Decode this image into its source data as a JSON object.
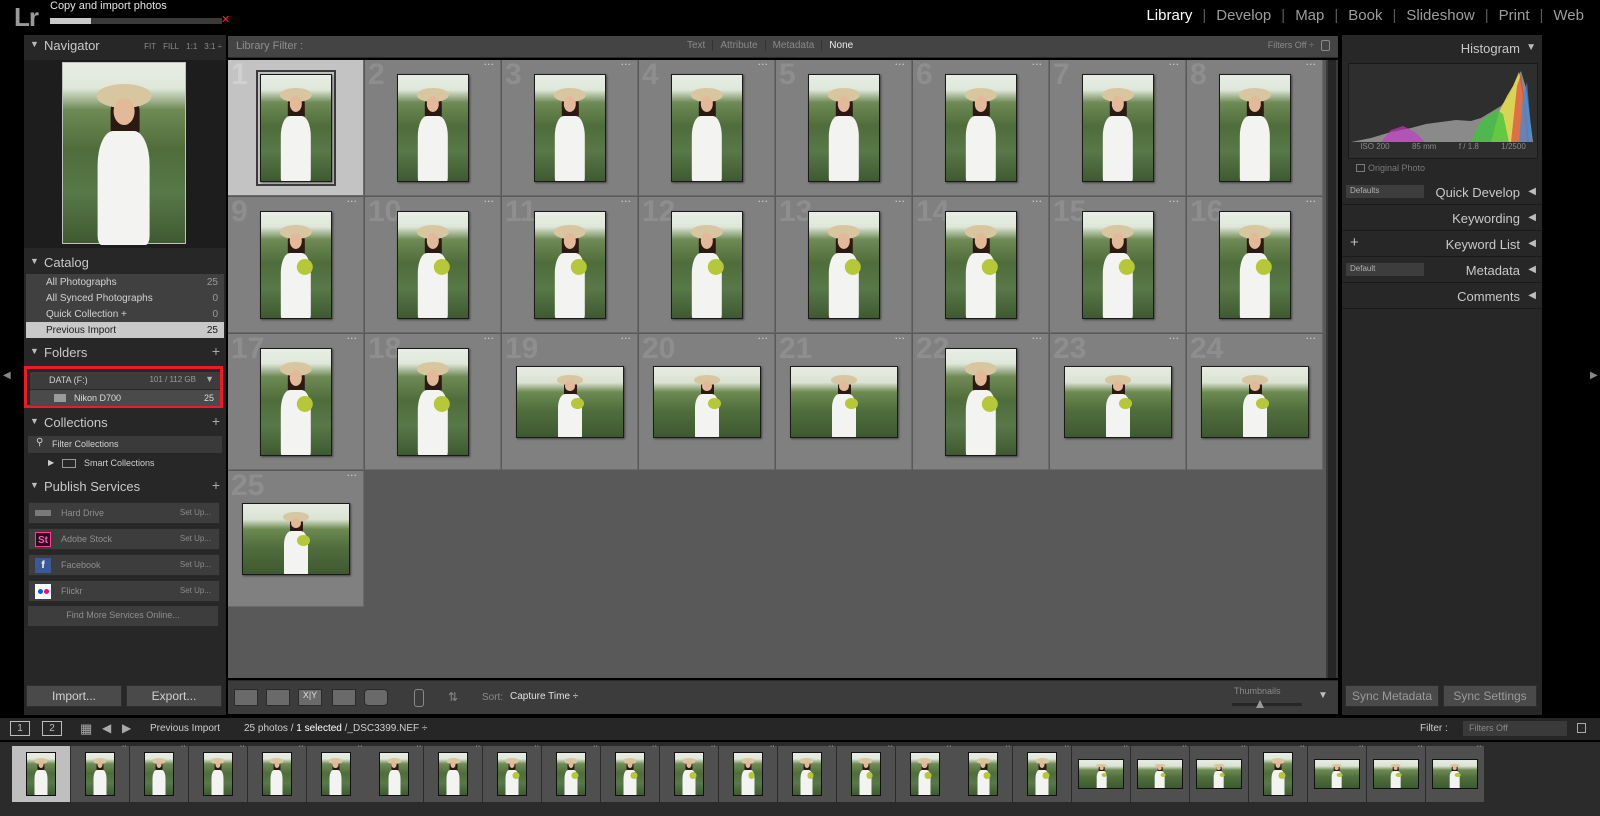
{
  "app": {
    "logo": "Lr"
  },
  "import_status": {
    "label": "Copy and import photos",
    "progress": 0.24
  },
  "modules": [
    "Library",
    "Develop",
    "Map",
    "Book",
    "Slideshow",
    "Print",
    "Web"
  ],
  "active_module": "Library",
  "navigator": {
    "title": "Navigator",
    "options": [
      "FIT",
      "FILL",
      "1:1",
      "3:1 ÷"
    ]
  },
  "catalog": {
    "title": "Catalog",
    "items": [
      {
        "label": "All Photographs",
        "count": "25"
      },
      {
        "label": "All Synced Photographs",
        "count": "0"
      },
      {
        "label": "Quick Collection +",
        "count": "0"
      },
      {
        "label": "Previous Import",
        "count": "25"
      }
    ]
  },
  "folders": {
    "title": "Folders",
    "volume": "DATA (F:)",
    "volume_size": "101 / 112 GB",
    "folder": "Nikon D700",
    "folder_count": "25"
  },
  "collections": {
    "title": "Collections",
    "filter": "Filter Collections",
    "smart": "Smart Collections"
  },
  "publish": {
    "title": "Publish Services",
    "services": [
      {
        "label": "Hard Drive",
        "setup": "Set Up...",
        "icon": "hard-drive-icon"
      },
      {
        "label": "Adobe Stock",
        "setup": "Set Up...",
        "icon": "adobe-stock-icon",
        "icon_text": "St"
      },
      {
        "label": "Facebook",
        "setup": "Set Up...",
        "icon": "facebook-icon",
        "icon_text": "f"
      },
      {
        "label": "Flickr",
        "setup": "Set Up...",
        "icon": "flickr-icon"
      }
    ],
    "find_more": "Find More Services Online..."
  },
  "left_buttons": {
    "import": "Import...",
    "export": "Export..."
  },
  "library_filter": {
    "title": "Library Filter :",
    "options": [
      "Text",
      "Attribute",
      "Metadata",
      "None"
    ],
    "selected": "None",
    "status": "Filters Off ÷"
  },
  "grid": {
    "photos": [
      {
        "n": "1",
        "orient": "portrait",
        "bouquet": false,
        "selected": true
      },
      {
        "n": "2",
        "orient": "portrait",
        "bouquet": false
      },
      {
        "n": "3",
        "orient": "portrait",
        "bouquet": false
      },
      {
        "n": "4",
        "orient": "portrait",
        "bouquet": false
      },
      {
        "n": "5",
        "orient": "portrait",
        "bouquet": false
      },
      {
        "n": "6",
        "orient": "portrait",
        "bouquet": false
      },
      {
        "n": "7",
        "orient": "portrait",
        "bouquet": false
      },
      {
        "n": "8",
        "orient": "portrait",
        "bouquet": false
      },
      {
        "n": "9",
        "orient": "portrait",
        "bouquet": true
      },
      {
        "n": "10",
        "orient": "portrait",
        "bouquet": true
      },
      {
        "n": "11",
        "orient": "portrait",
        "bouquet": true
      },
      {
        "n": "12",
        "orient": "portrait",
        "bouquet": true
      },
      {
        "n": "13",
        "orient": "portrait",
        "bouquet": true
      },
      {
        "n": "14",
        "orient": "portrait",
        "bouquet": true
      },
      {
        "n": "15",
        "orient": "portrait",
        "bouquet": true
      },
      {
        "n": "16",
        "orient": "portrait",
        "bouquet": true
      },
      {
        "n": "17",
        "orient": "portrait",
        "bouquet": true
      },
      {
        "n": "18",
        "orient": "portrait",
        "bouquet": true
      },
      {
        "n": "19",
        "orient": "landscape",
        "bouquet": true
      },
      {
        "n": "20",
        "orient": "landscape",
        "bouquet": true
      },
      {
        "n": "21",
        "orient": "landscape",
        "bouquet": true
      },
      {
        "n": "22",
        "orient": "portrait",
        "bouquet": true
      },
      {
        "n": "23",
        "orient": "landscape",
        "bouquet": true
      },
      {
        "n": "24",
        "orient": "landscape",
        "bouquet": true
      },
      {
        "n": "25",
        "orient": "landscape",
        "bouquet": true
      }
    ]
  },
  "toolbar": {
    "sort_label": "Sort:",
    "sort_value": "Capture Time ÷",
    "thumbnails_label": "Thumbnails",
    "thumbnail_size": 0.4
  },
  "right_panel": {
    "histogram": "Histogram",
    "histo_info": [
      "ISO 200",
      "85 mm",
      "f / 1.8",
      "1/2500"
    ],
    "original_photo": "Original Photo",
    "sections": [
      {
        "title": "Quick Develop",
        "select": "Defaults"
      },
      {
        "title": "Keywording"
      },
      {
        "title": "Keyword List",
        "plus": true
      },
      {
        "title": "Metadata",
        "select": "Default"
      },
      {
        "title": "Comments"
      }
    ],
    "sync_metadata": "Sync Metadata",
    "sync_settings": "Sync Settings"
  },
  "filmstrip": {
    "screen1": "1",
    "screen2": "2",
    "source": "Previous Import",
    "count_prefix": "25 photos /",
    "count_selected": "1 selected",
    "count_file": "/_DSC3399.NEF ÷",
    "filter_label": "Filter :",
    "filter_value": "Filters Off"
  },
  "colors": {
    "accent_box": "#ee1b24",
    "grid_bg": "#595959",
    "cell_bg": "#808080",
    "selected_cell": "#c3c3c3"
  }
}
